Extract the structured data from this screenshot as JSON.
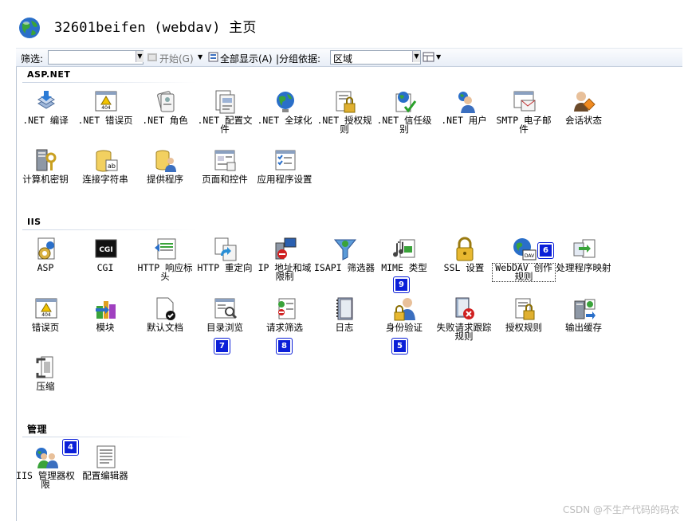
{
  "header": {
    "title": "32601beifen (webdav) 主页"
  },
  "toolbar": {
    "filter_label": "筛选:",
    "start_label": "开始(G)",
    "show_all_label": "全部显示(A)",
    "group_label": "|分组依据:",
    "group_value": "区域"
  },
  "sections": {
    "aspnet": "ASP.NET",
    "iis": "IIS",
    "mgmt": "管理"
  },
  "tiles": {
    "net_compile": ".NET 编译",
    "net_error": ".NET 错误页",
    "net_role": ".NET 角色",
    "net_config": ".NET 配置文件",
    "net_global": ".NET 全球化",
    "net_auth": ".NET 授权规则",
    "net_trust": ".NET 信任级别",
    "net_user": ".NET 用户",
    "smtp": "SMTP 电子邮件",
    "session": "会话状态",
    "machine_key": "计算机密钥",
    "conn_string": "连接字符串",
    "provider": "提供程序",
    "pages": "页面和控件",
    "app_settings": "应用程序设置",
    "asp": "ASP",
    "cgi": "CGI",
    "http_resp": "HTTP 响应标头",
    "http_redirect": "HTTP 重定向",
    "ip_restrict": "IP 地址和域限制",
    "isapi": "ISAPI 筛选器",
    "mime": "MIME 类型",
    "ssl": "SSL 设置",
    "webdav": "WebDAV 创作规则",
    "handler": "处理程序映射",
    "error_pages": "错误页",
    "modules": "模块",
    "default_doc": "默认文档",
    "dir_browse": "目录浏览",
    "req_filter": "请求筛选",
    "logging": "日志",
    "authn": "身份验证",
    "failed_req": "失败请求跟踪规则",
    "authz": "授权规则",
    "output_cache": "输出缓存",
    "compress": "压缩",
    "iis_mgr_perm": "IIS 管理器权限",
    "config_editor": "配置编辑器"
  },
  "badges": {
    "b4": "4",
    "b5": "5",
    "b6": "6",
    "b7": "7",
    "b8": "8",
    "b9": "9"
  },
  "watermark": "CSDN @不生产代码的码农",
  "colors": {
    "badge": "#0b1fd8",
    "toolbar": "#e8eef7"
  }
}
